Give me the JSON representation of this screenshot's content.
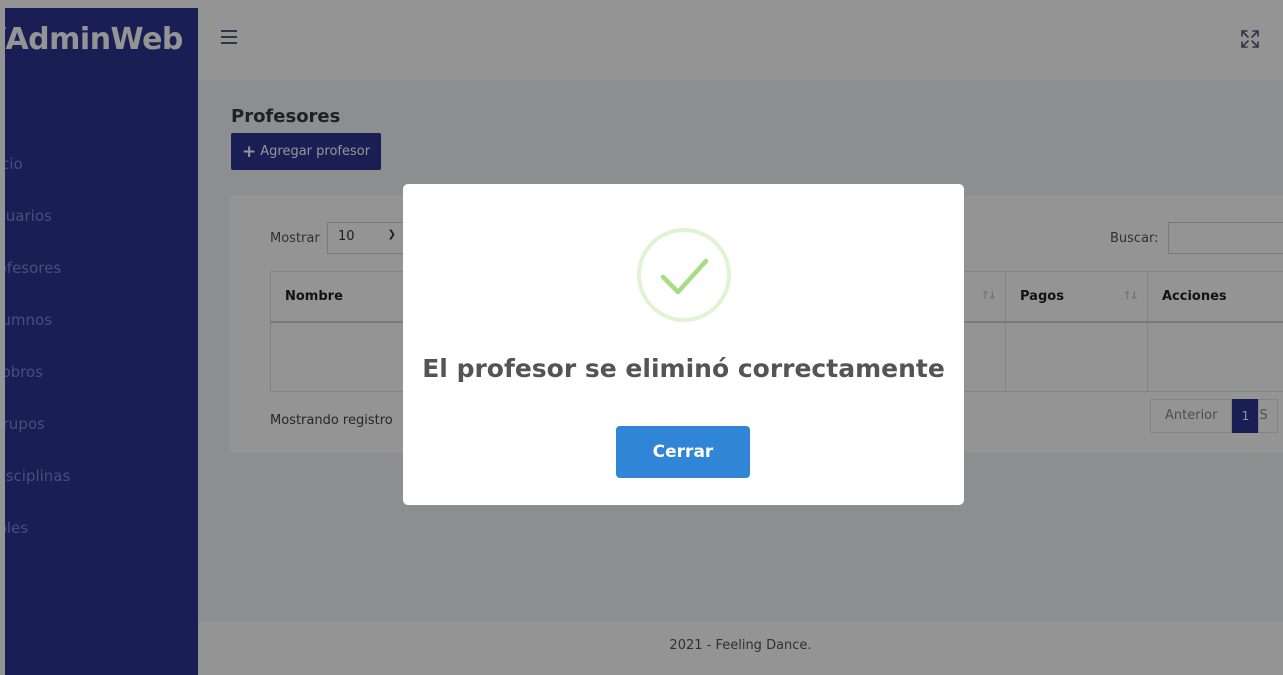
{
  "app": {
    "brand": "/AdminWeb"
  },
  "sidebar": {
    "items": [
      {
        "label": "Inicio"
      },
      {
        "label": "Usuarios"
      },
      {
        "label": "Profesores"
      },
      {
        "label": "Alumnos"
      },
      {
        "label": "Cobros"
      },
      {
        "label": "Grupos"
      },
      {
        "label": "Disciplinas"
      },
      {
        "label": "Roles"
      }
    ]
  },
  "header": {
    "menu_icon": "hamburger-icon",
    "fullscreen_icon": "expand-icon"
  },
  "page": {
    "title": "Profesores",
    "add_button": "Agregar profesor",
    "add_icon": "plus-icon"
  },
  "table": {
    "show_label": "Mostrar",
    "page_size": "10",
    "search_label": "Buscar:",
    "search_value": "",
    "columns": [
      "Nombre",
      "",
      "Pagos",
      "Acciones"
    ],
    "info": "Mostrando registro",
    "pagination": {
      "previous": "Anterior",
      "current": "1",
      "next": "S"
    }
  },
  "footer": {
    "text": "2021 - Feeling Dance."
  },
  "modal": {
    "icon": "check-icon",
    "title": "El profesor se eliminó correctamente",
    "button": "Cerrar",
    "colors": {
      "success": "#a5dc86",
      "confirm": "#3085d6"
    }
  },
  "colors": {
    "primary": "#2c3592"
  }
}
